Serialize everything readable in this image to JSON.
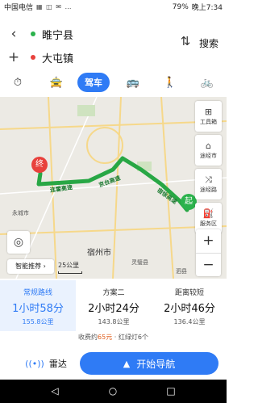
{
  "status_bar": {
    "carrier": "中国电信",
    "icons": "▦ ◫ ✉ …",
    "battery": "79%",
    "time": "晚上7:34"
  },
  "route": {
    "origin": "睢宁县",
    "destination": "大屯镇",
    "search_label": "搜索",
    "origin_dot_color": "#2bb24c",
    "destination_dot_color": "#e8413c"
  },
  "modes": {
    "taxi_icon": "⏱",
    "bus_car_icon": "🚖",
    "drive_label": "驾车",
    "bus_icon": "🚌",
    "walk_icon": "🚶",
    "bike_icon": "🚲"
  },
  "map": {
    "labels": [
      {
        "name": "永城市",
        "big": false
      },
      {
        "name": "宿州市",
        "big": true
      },
      {
        "name": "灵璧县",
        "big": false
      },
      {
        "name": "泗县",
        "big": false
      }
    ],
    "road_labels": [
      "连霍高速",
      "京台高速",
      "宿徐高速"
    ],
    "start_marker": "起",
    "end_marker": "终",
    "route_color": "#28a745",
    "tools": [
      {
        "icon": "toolbox-icon",
        "glyph": "⊞",
        "label": "工具箱"
      },
      {
        "icon": "city-icon",
        "glyph": "⌂",
        "label": "途经市"
      },
      {
        "icon": "waypoint-icon",
        "glyph": "⤨",
        "label": "途经路"
      },
      {
        "icon": "service-icon",
        "glyph": "⛽",
        "label": "服务区"
      }
    ],
    "smart_label": "智能推荐",
    "smart_arrow": "›",
    "scale": "25公里",
    "zoom_in": "+",
    "zoom_out": "−",
    "locate_glyph": "◎"
  },
  "plans": [
    {
      "name": "常规路线",
      "time": "1小时58分",
      "distance": "155.8公里",
      "selected": true
    },
    {
      "name": "方案二",
      "time": "2小时24分",
      "distance": "143.8公里",
      "selected": false
    },
    {
      "name": "距离较短",
      "time": "2小时46分",
      "distance": "136.4公里",
      "selected": false
    }
  ],
  "fee": {
    "prefix": "收费约",
    "amount": "65元",
    "separator": " · ",
    "lights": "红绿灯6个"
  },
  "actions": {
    "radar_label": "雷达",
    "radar_icon": "((•))",
    "navigate_label": "开始导航",
    "navigate_icon": "▲"
  },
  "system_nav": {
    "back": "◁",
    "home": "○",
    "recent": "□"
  }
}
